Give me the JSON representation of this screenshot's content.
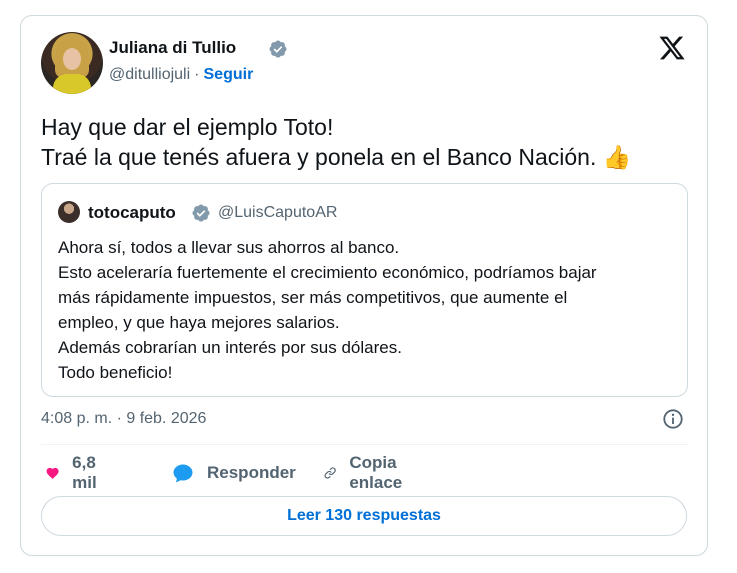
{
  "author": {
    "name": "Juliana di Tullio",
    "handle": "@ditulliojuli",
    "separator": "·",
    "follow_label": "Seguir"
  },
  "tweet": {
    "lines": [
      "Hay que dar el ejemplo Toto!",
      "Traé la que tenés afuera y ponela en el Banco Nación."
    ],
    "emoji": "👍"
  },
  "quoted": {
    "name": "totocaputo",
    "handle": "@LuisCaputoAR",
    "lines": [
      "Ahora sí, todos a llevar sus ahorros al banco.",
      "Esto aceleraría fuertemente el crecimiento económico, podríamos bajar",
      "más rápidamente impuestos, ser más competitivos, que aumente el",
      "empleo, y que haya mejores salarios.",
      "Además cobrarían un interés por sus dólares.",
      "Todo beneficio!"
    ]
  },
  "meta": {
    "timestamp": "4:08 p. m. · 9 feb. 2026"
  },
  "actions": {
    "like_count": "6,8 mil",
    "reply_label": "Responder",
    "copy_label": "Copia enlace"
  },
  "footer": {
    "read_replies_label": "Leer 130 respuestas"
  },
  "colors": {
    "link": "#006fd6",
    "like": "#f91880",
    "reply": "#1d9bf0",
    "verified": "#829aab",
    "muted": "#536471"
  },
  "icons": [
    "x-logo-icon",
    "verified-badge-icon",
    "heart-icon",
    "reply-bubble-icon",
    "link-icon",
    "info-icon"
  ]
}
